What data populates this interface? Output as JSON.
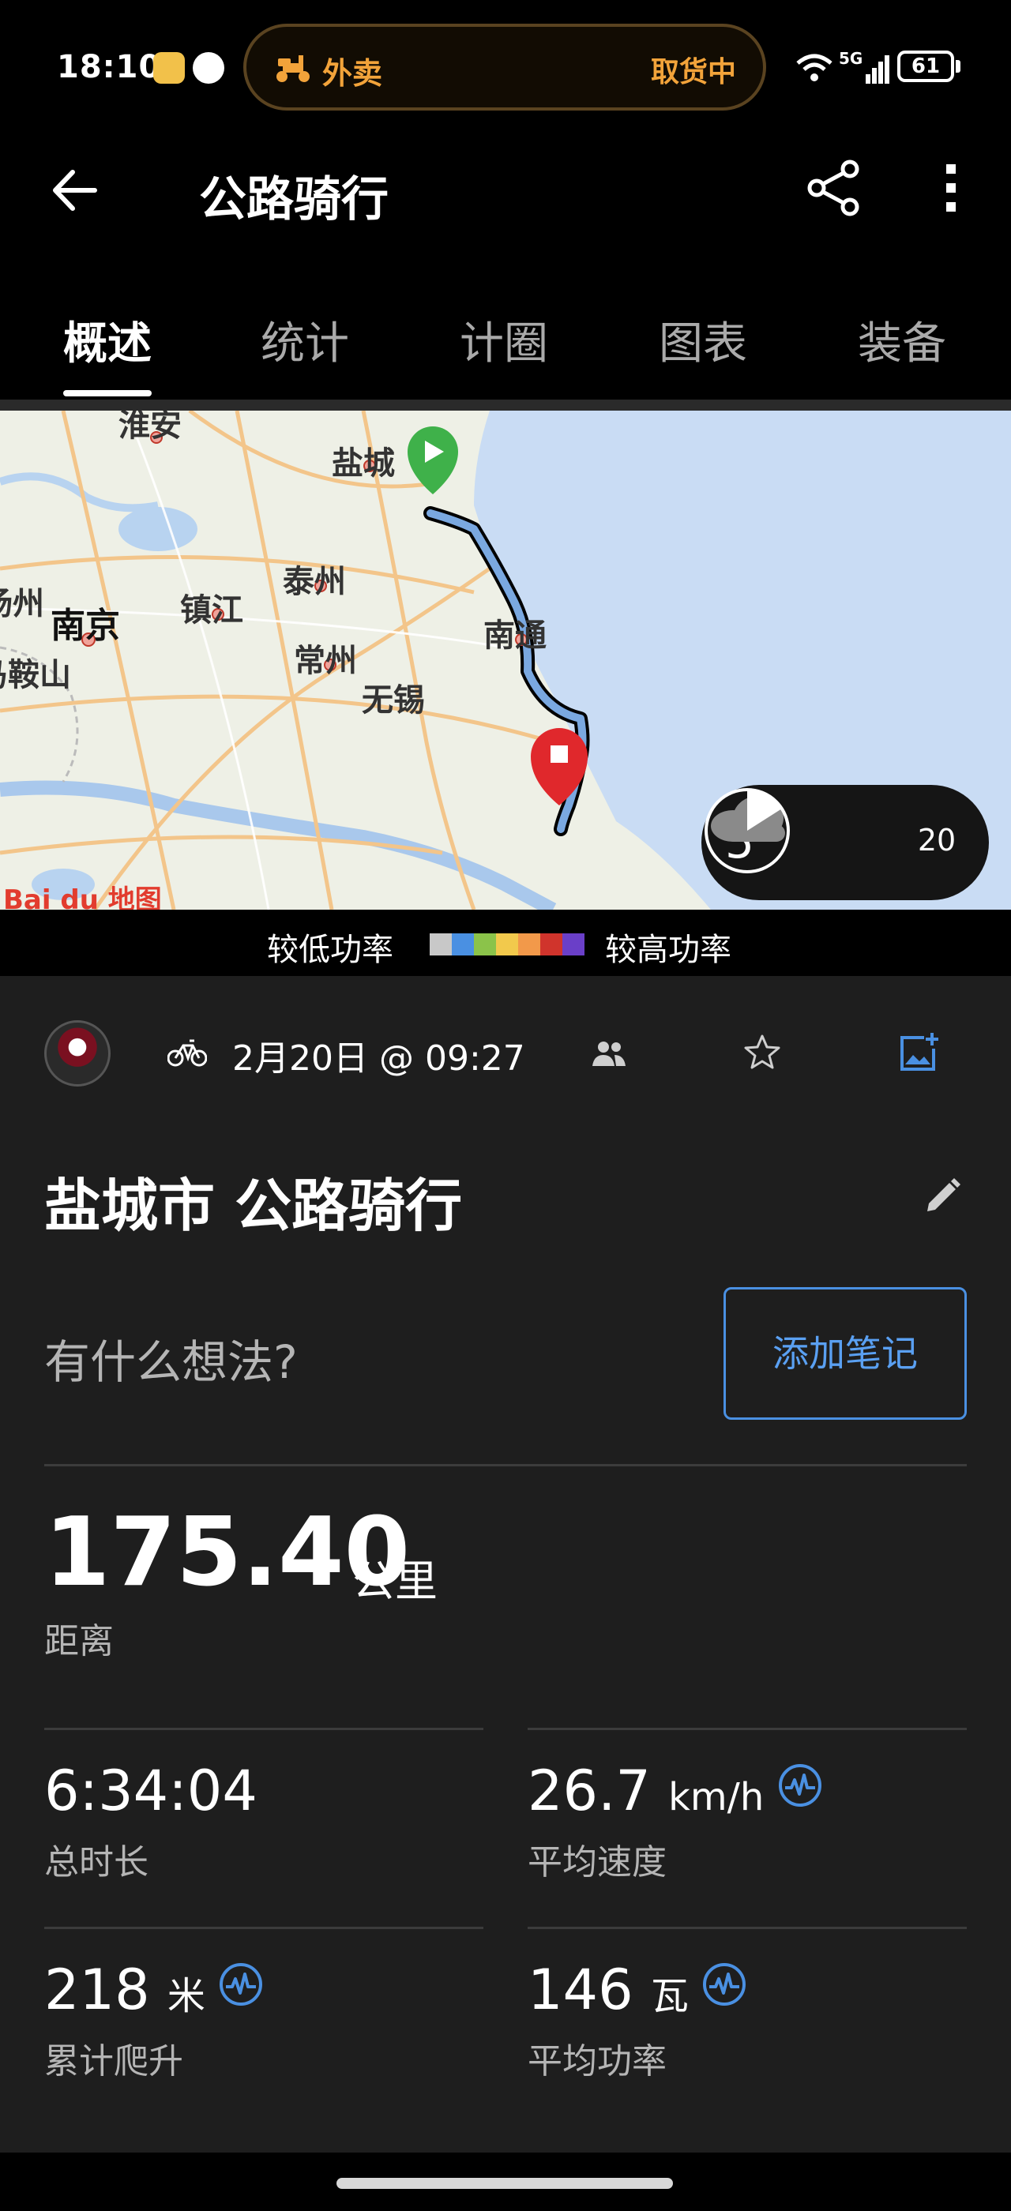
{
  "status_bar": {
    "time": "18:10",
    "pill_label": "外卖",
    "pill_status": "取货中",
    "network": "5G",
    "battery": "61"
  },
  "app_bar": {
    "title": "公路骑行"
  },
  "tabs": [
    {
      "label": "概述",
      "active": true
    },
    {
      "label": "统计",
      "active": false
    },
    {
      "label": "计圈",
      "active": false
    },
    {
      "label": "图表",
      "active": false
    },
    {
      "label": "装备",
      "active": false
    }
  ],
  "map": {
    "cities": [
      "淮安",
      "盐城",
      "泰州",
      "扬州",
      "镇江",
      "南京",
      "常州",
      "南通",
      "无锡",
      "马鞍山"
    ],
    "attribution": "Bai du 地图",
    "weather": {
      "temperature": "5°",
      "wind": "20"
    }
  },
  "power_legend": {
    "low_label": "较低功率",
    "high_label": "较高功率",
    "colors": [
      "#c8c8c8",
      "#4a90e2",
      "#8bc34a",
      "#f2c94c",
      "#f2994a",
      "#d0342c",
      "#6a3fc8"
    ]
  },
  "activity": {
    "date": "2月20日 @ 09:27",
    "title": "盐城市 公路骑行",
    "thoughts_placeholder": "有什么想法?",
    "add_note_label": "添加笔记",
    "distance": {
      "value": "175.40",
      "unit": "公里",
      "label": "距离"
    },
    "stats": [
      {
        "value": "6:34:04",
        "unit": "",
        "label": "总时长"
      },
      {
        "value": "26.7",
        "unit": "km/h",
        "label": "平均速度"
      },
      {
        "value": "218",
        "unit": "米",
        "label": "累计爬升"
      },
      {
        "value": "146",
        "unit": "瓦",
        "label": "平均功率"
      }
    ]
  },
  "colors": {
    "accent": "#4a90e2",
    "delivery": "#f2a33a",
    "start_marker": "#3fb14a",
    "end_marker": "#e0282c"
  }
}
